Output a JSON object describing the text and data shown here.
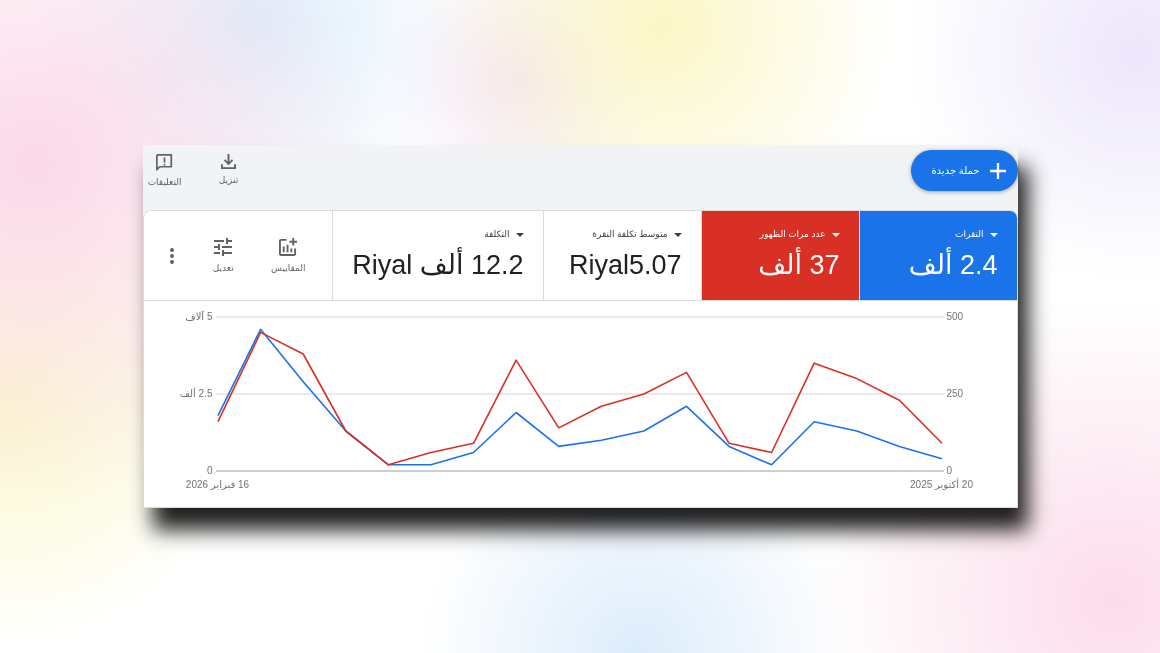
{
  "toolbar": {
    "new_campaign_button": {
      "label": "حملة جديدة"
    },
    "actions": [
      {
        "kind": "download",
        "label": "تنزيل"
      },
      {
        "kind": "feedback",
        "label": "التعليقات"
      }
    ]
  },
  "metrics": [
    {
      "label": "النقرات",
      "value": "2.4 ألف",
      "selected": true,
      "color": "#1a73e8"
    },
    {
      "label": "عدد مرات الظهور",
      "value": "37 ألف",
      "selected": true,
      "color": "#d93025"
    },
    {
      "label": "متوسط تكلفة النقرة",
      "value": "Riyal5.07",
      "selected": false
    },
    {
      "label": "التكلفة",
      "value": "12.2 ألف Riyal",
      "selected": false
    }
  ],
  "metric_tools": [
    {
      "kind": "metrics",
      "label": "المقاييس"
    },
    {
      "kind": "adjust",
      "label": "تعديل"
    },
    {
      "kind": "more"
    }
  ],
  "chart": {
    "chart_data": {
      "type": "line",
      "categories": [
        "16 فبراير 2026",
        null,
        null,
        null,
        null,
        null,
        null,
        null,
        null,
        null,
        null,
        null,
        null,
        null,
        null,
        null,
        null,
        "20 أكتوبر 2025"
      ],
      "ylim": [
        0,
        5
      ],
      "yticks": [
        0,
        {
          "value": 2.5,
          "label": "2.5 ألف"
        },
        {
          "value": 5,
          "label": "5 آلاف"
        }
      ],
      "y2lim": [
        0,
        500
      ],
      "y2ticks": [
        0,
        250,
        500
      ],
      "series": [
        {
          "color": "#1a73e8",
          "axis": "y2",
          "values": [
            180,
            460,
            290,
            130,
            20,
            20,
            60,
            190,
            80,
            100,
            130,
            210,
            80,
            20,
            160,
            130,
            80,
            40
          ]
        },
        {
          "color": "#d93025",
          "values": [
            1.6,
            4.5,
            3.8,
            1.3,
            0.2,
            0.6,
            0.9,
            3.6,
            1.4,
            2.1,
            2.5,
            3.2,
            0.9,
            0.6,
            3.5,
            3.0,
            2.3,
            0.9
          ]
        }
      ]
    }
  }
}
